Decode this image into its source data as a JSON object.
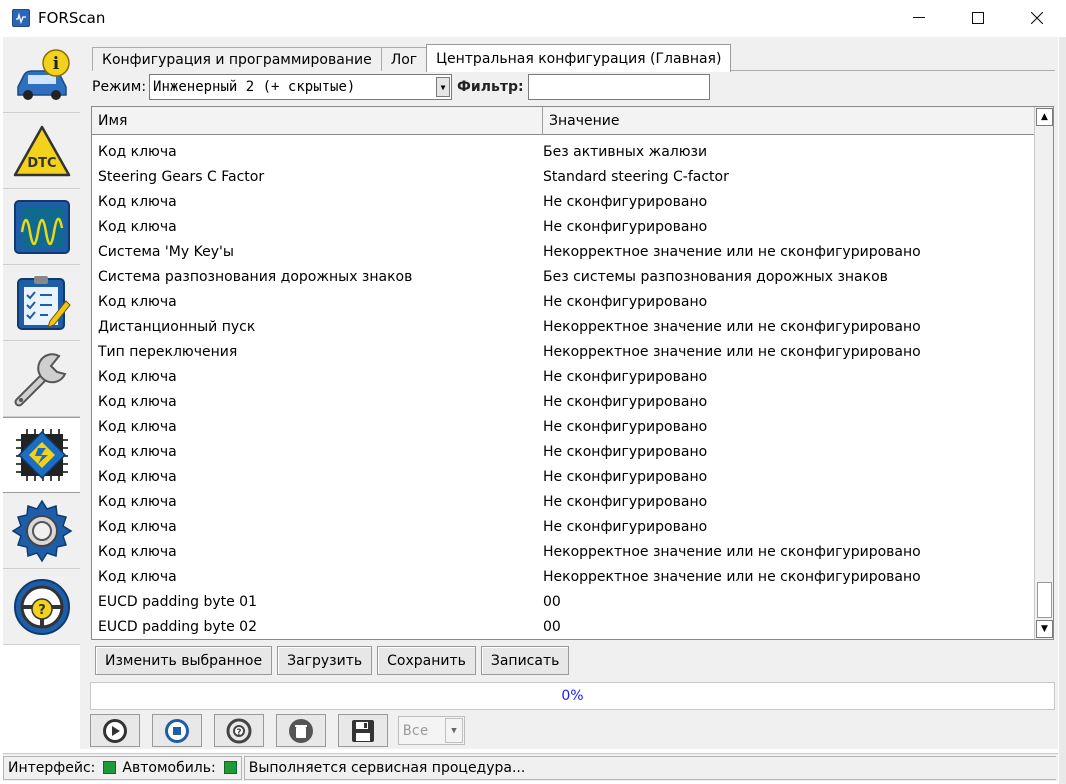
{
  "window": {
    "title": "FORScan"
  },
  "sidebar": {
    "items": [
      {
        "icon": "info-car-icon"
      },
      {
        "icon": "dtc-icon"
      },
      {
        "icon": "oscilloscope-icon"
      },
      {
        "icon": "checklist-icon"
      },
      {
        "icon": "wrench-icon"
      },
      {
        "icon": "chip-icon",
        "active": true
      },
      {
        "icon": "gear-icon"
      },
      {
        "icon": "help-wheel-icon"
      }
    ]
  },
  "tabs": [
    {
      "label": "Конфигурация и программирование"
    },
    {
      "label": "Лог"
    },
    {
      "label": "Центральная конфигурация (Главная)",
      "active": true
    }
  ],
  "toolbar": {
    "mode_label": "Режим:",
    "mode_value": "Инженерный 2 (+ скрытые)",
    "filter_label": "Фильтр:",
    "filter_value": ""
  },
  "grid": {
    "columns": [
      "Имя",
      "Значение"
    ],
    "rows": [
      {
        "name": "Код ключа",
        "value": "Без активных жалюзи"
      },
      {
        "name": "Steering Gears C Factor",
        "value": "Standard steering C-factor"
      },
      {
        "name": "Код ключа",
        "value": "Не сконфигурировано"
      },
      {
        "name": "Код ключа",
        "value": "Не сконфигурировано"
      },
      {
        "name": "Система 'My Key'ы",
        "value": "Некорректное значение или не сконфигурировано"
      },
      {
        "name": "Система разпознования дорожных знаков",
        "value": "Без системы разпознования дорожных знаков"
      },
      {
        "name": "Код ключа",
        "value": "Не сконфигурировано"
      },
      {
        "name": "Дистанционный пуск",
        "value": "Некорректное значение или не сконфигурировано"
      },
      {
        "name": "Тип переключения",
        "value": "Некорректное значение или не сконфигурировано"
      },
      {
        "name": "Код ключа",
        "value": "Не сконфигурировано"
      },
      {
        "name": "Код ключа",
        "value": "Не сконфигурировано"
      },
      {
        "name": "Код ключа",
        "value": "Не сконфигурировано"
      },
      {
        "name": "Код ключа",
        "value": "Не сконфигурировано"
      },
      {
        "name": "Код ключа",
        "value": "Не сконфигурировано"
      },
      {
        "name": "Код ключа",
        "value": "Не сконфигурировано"
      },
      {
        "name": "Код ключа",
        "value": "Не сконфигурировано"
      },
      {
        "name": "Код ключа",
        "value": "Некорректное значение или не сконфигурировано"
      },
      {
        "name": "Код ключа",
        "value": "Некорректное значение или не сконфигурировано"
      },
      {
        "name": "EUCD padding byte 01",
        "value": "00"
      },
      {
        "name": "EUCD padding byte 02",
        "value": "00"
      }
    ]
  },
  "actions": {
    "edit_label": "Изменить выбранное",
    "load_label": "Загрузить",
    "save_label": "Сохранить",
    "write_label": "Записать"
  },
  "progress": {
    "text": "0%",
    "value": 0
  },
  "controls": {
    "select_value": "Все"
  },
  "status": {
    "interface_label": "Интерфейс:",
    "vehicle_label": "Автомобиль:",
    "message": "Выполняется сервисная процедура..."
  },
  "colors": {
    "status_ok": "#1f9a3a",
    "progress_text": "#1a1aff"
  }
}
